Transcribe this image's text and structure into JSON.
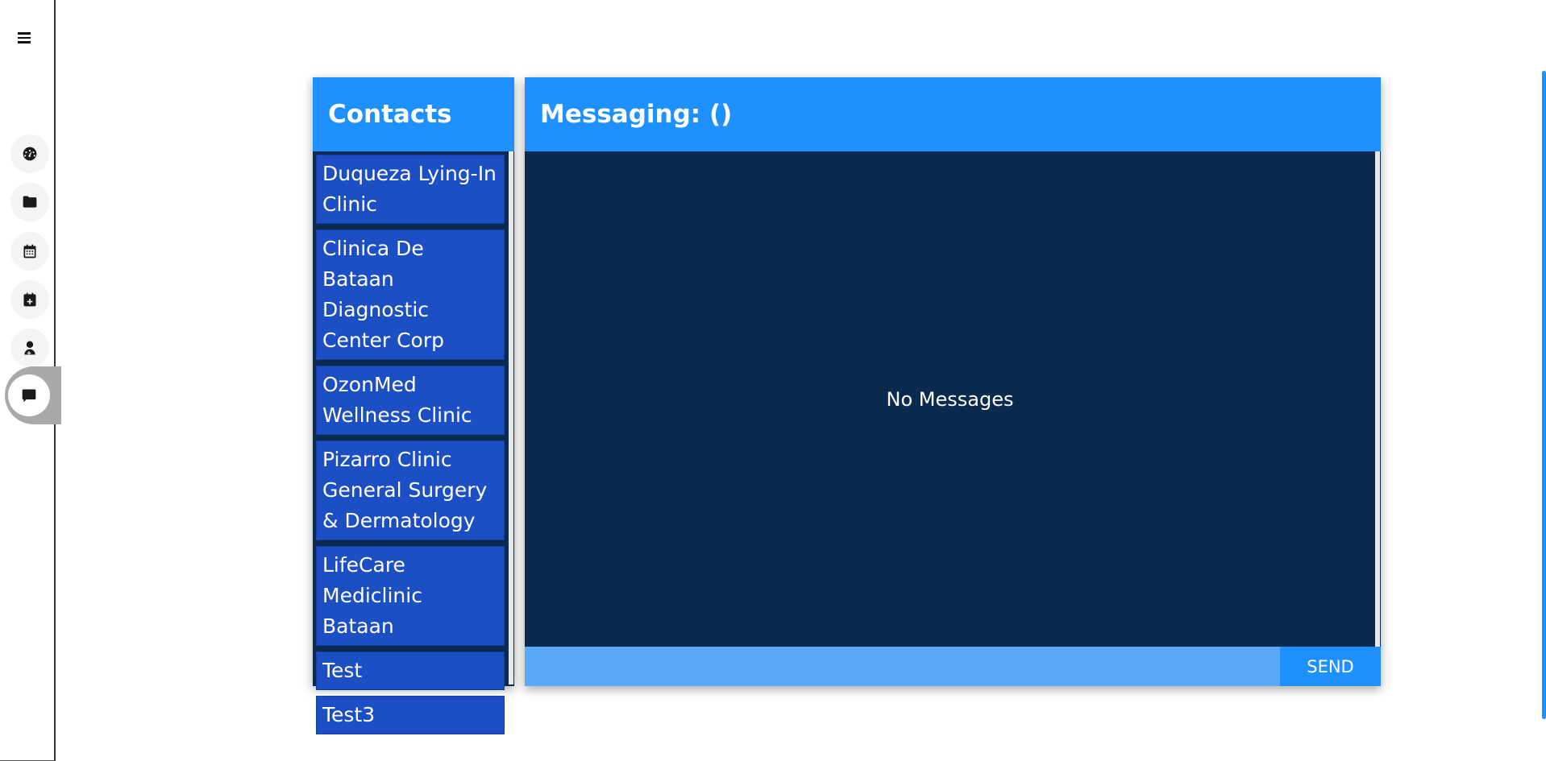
{
  "sidebar": {
    "menu_icon": "hamburger-menu-icon",
    "items": [
      {
        "icon": "dashboard-gauge-icon",
        "label": "Dashboard"
      },
      {
        "icon": "folder-icon",
        "label": "Records"
      },
      {
        "icon": "calendar-icon",
        "label": "Calendar"
      },
      {
        "icon": "calendar-plus-icon",
        "label": "Appointments"
      },
      {
        "icon": "user-doctor-icon",
        "label": "Doctors"
      },
      {
        "icon": "chat-message-icon",
        "label": "Messages",
        "active": true
      }
    ]
  },
  "contacts": {
    "title": "Contacts",
    "items": [
      {
        "label": "Duqueza Lying-In Clinic"
      },
      {
        "label": "Clinica De Bataan Diagnostic Center Corp"
      },
      {
        "label": "OzonMed Wellness Clinic"
      },
      {
        "label": "Pizarro Clinic General Surgery & Dermatology"
      },
      {
        "label": "LifeCare Mediclinic Bataan"
      },
      {
        "label": "Test"
      },
      {
        "label": "Test3"
      }
    ]
  },
  "messaging": {
    "title": "Messaging: ()",
    "empty_text": "No Messages",
    "input_value": "",
    "input_placeholder": "",
    "send_label": "SEND"
  },
  "colors": {
    "accent": "#1e90ff",
    "panel_bg": "#0b2a4d",
    "contact_item": "#1d4fc4",
    "input_bg": "#5aa9f6"
  }
}
